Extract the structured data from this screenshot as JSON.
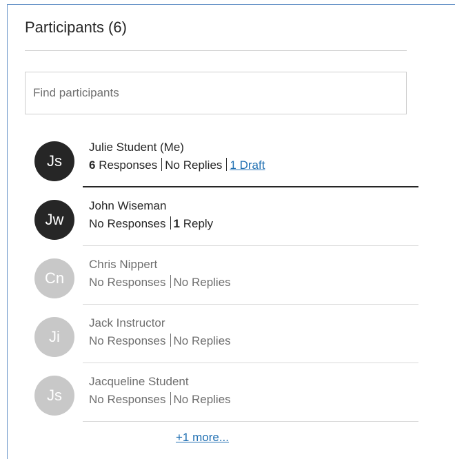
{
  "panel": {
    "title": "Participants (6)",
    "search": {
      "placeholder": "Find participants",
      "value": ""
    },
    "more_link": "+1 more..."
  },
  "colors": {
    "accent_link": "#1f6fb2",
    "avatar_active": "#262626",
    "avatar_inactive": "#c8c8c8",
    "panel_border": "#6a95c8"
  },
  "participants": [
    {
      "initials": "Js",
      "name": "Julie Student (Me)",
      "responses_count": "6",
      "responses_label": "Responses",
      "replies_text": "No Replies",
      "draft_text": "1 Draft",
      "active": true
    },
    {
      "initials": "Jw",
      "name": "John Wiseman",
      "responses_text": "No Responses",
      "replies_count": "1",
      "replies_label": "Reply",
      "active": true
    },
    {
      "initials": "Cn",
      "name": "Chris Nippert",
      "responses_text": "No Responses",
      "replies_text": "No Replies",
      "active": false
    },
    {
      "initials": "Ji",
      "name": "Jack Instructor",
      "responses_text": "No Responses",
      "replies_text": "No Replies",
      "active": false
    },
    {
      "initials": "Js",
      "name": "Jacqueline Student",
      "responses_text": "No Responses",
      "replies_text": "No Replies",
      "active": false
    }
  ]
}
